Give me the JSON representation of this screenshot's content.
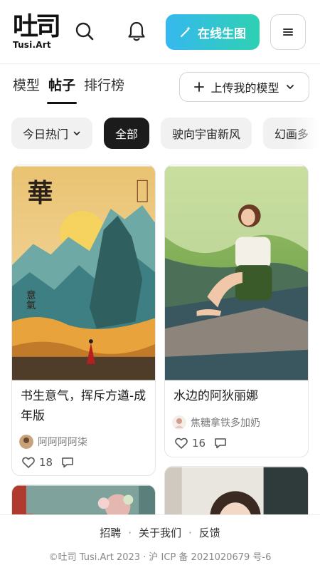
{
  "header": {
    "logo_text": "吐司",
    "logo_sub": "Tusi.Art",
    "generate_label": "在线生图"
  },
  "tabs": [
    {
      "label": "模型",
      "active": false
    },
    {
      "label": "帖子",
      "active": true
    },
    {
      "label": "排行榜",
      "active": false
    }
  ],
  "upload_label": "上传我的模型",
  "chips": [
    {
      "label": "今日热门",
      "dropdown": true,
      "active": false
    },
    {
      "label": "全部",
      "active": true
    },
    {
      "label": "驶向宇宙新风",
      "active": false
    },
    {
      "label": "幻画多",
      "active": false
    }
  ],
  "posts": [
    {
      "title": "书生意气，挥斥方遒-成年版",
      "author": "阿阿阿阿柒",
      "likes": "18",
      "image_text_1": "華",
      "image_text_2": "意氣"
    },
    {
      "title": "水边的阿狄丽娜",
      "author": "焦糖拿铁多加奶",
      "likes": "16"
    }
  ],
  "footer": {
    "links": [
      "招聘",
      "关于我们",
      "反馈"
    ],
    "copyright": "©吐司 Tusi.Art 2023 · 沪 ICP 备 2021020679 号-6"
  },
  "colors": {
    "accent_start": "#36b8ef",
    "accent_end": "#2ed1b2"
  }
}
